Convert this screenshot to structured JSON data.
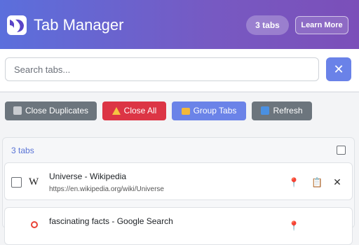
{
  "header": {
    "title": "Tab Manager",
    "tab_count_badge": "3 tabs",
    "learn_more_label": "Learn More"
  },
  "search": {
    "placeholder": "Search tabs...",
    "value": ""
  },
  "toolbar": {
    "close_duplicates_label": "Close Duplicates",
    "close_all_label": "Close All",
    "group_tabs_label": "Group Tabs",
    "refresh_label": "Refresh"
  },
  "tab_list": {
    "count_label": "3 tabs",
    "tabs": [
      {
        "title": "Universe - Wikipedia",
        "url": "https://en.wikipedia.org/wiki/Universe",
        "favicon": "wikipedia-icon",
        "checked": false
      },
      {
        "title": "fascinating facts - Google Search",
        "url": "",
        "favicon": "google-icon",
        "checked": false
      }
    ]
  },
  "colors": {
    "header_gradient_start": "#5b6fdc",
    "header_gradient_end": "#7b4fb9",
    "primary": "#6b83e8",
    "danger": "#dc3545",
    "secondary": "#6c757d",
    "count_text": "#5a74d6"
  },
  "icons": {
    "logo": "tab-manager-logo",
    "clear": "close-icon",
    "close_duplicates": "trash-icon",
    "close_all": "warning-icon",
    "group_tabs": "folder-icon",
    "refresh": "refresh-icon",
    "pin": "pin-icon",
    "copy": "clipboard-icon",
    "close_tab": "close-icon"
  }
}
